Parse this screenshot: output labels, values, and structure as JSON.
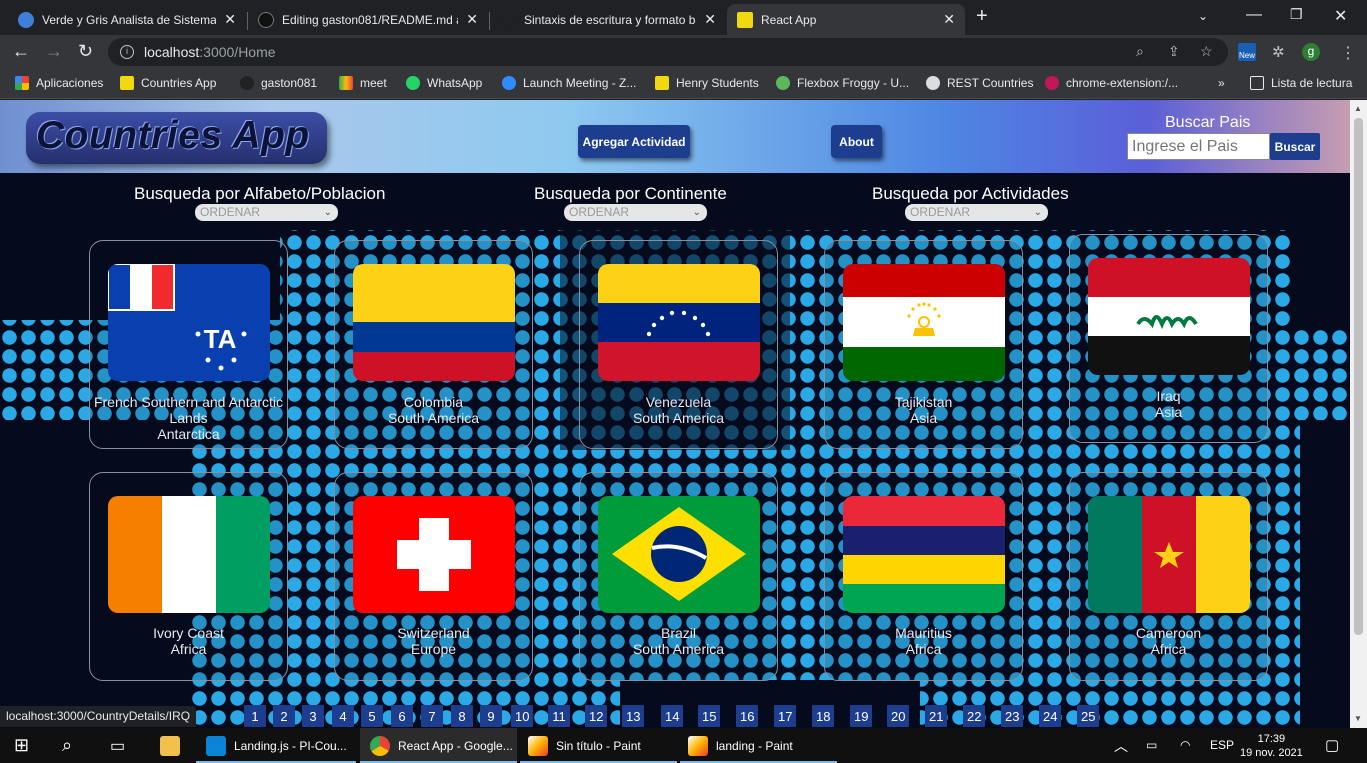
{
  "browser": {
    "tabs": [
      {
        "title": "Verde y Gris Analista de Sistemas",
        "active": false
      },
      {
        "title": "Editing gaston081/README.md a",
        "active": false
      },
      {
        "title": "Sintaxis de escritura y formato bá",
        "active": false
      },
      {
        "title": "React App",
        "active": true
      }
    ],
    "url_host": "localhost",
    "url_path": ":3000/Home",
    "bookmarks": [
      "Aplicaciones",
      "Countries App",
      "gaston081",
      "meet",
      "WhatsApp",
      "Launch Meeting - Z...",
      "Henry Students",
      "Flexbox Froggy - U...",
      "REST Countries",
      "chrome-extension:/..."
    ],
    "reading_list": "Lista de lectura",
    "extension_badge": "New",
    "profile_letter": "g"
  },
  "app": {
    "logo": "Countries App",
    "add_activity_label": "Agregar Actividad",
    "about_label": "About",
    "search": {
      "title": "Buscar Pais",
      "placeholder": "Ingrese el Pais",
      "button": "Buscar"
    },
    "filters": [
      {
        "title": "Busqueda por Alfabeto/Poblacion",
        "selected": "ORDENAR"
      },
      {
        "title": "Busqueda por Continente",
        "selected": "ORDENAR"
      },
      {
        "title": "Busqueda por Actividades",
        "selected": "ORDENAR"
      }
    ],
    "countries": [
      {
        "name": "French Southern and Antarctic Lands",
        "continent": "Antarctica",
        "flag": "french-southern-lands"
      },
      {
        "name": "Colombia",
        "continent": "South America",
        "flag": "colombia"
      },
      {
        "name": "Venezuela",
        "continent": "South America",
        "flag": "venezuela"
      },
      {
        "name": "Tajikistan",
        "continent": "Asia",
        "flag": "tajikistan"
      },
      {
        "name": "Iraq",
        "continent": "Asia",
        "flag": "iraq"
      },
      {
        "name": "Ivory Coast",
        "continent": "Africa",
        "flag": "ivory-coast"
      },
      {
        "name": "Switzerland",
        "continent": "Europe",
        "flag": "switzerland"
      },
      {
        "name": "Brazil",
        "continent": "South America",
        "flag": "brazil"
      },
      {
        "name": "Mauritius",
        "continent": "Africa",
        "flag": "mauritius"
      },
      {
        "name": "Cameroon",
        "continent": "Africa",
        "flag": "cameroon"
      }
    ],
    "pages": [
      "1",
      "2",
      "3",
      "4",
      "5",
      "6",
      "7",
      "8",
      "9",
      "10",
      "11",
      "12",
      "13",
      "14",
      "15",
      "16",
      "17",
      "18",
      "19",
      "20",
      "21",
      "22",
      "23",
      "24",
      "25"
    ],
    "status_url": "localhost:3000/CountryDetails/IRQ"
  },
  "taskbar": {
    "items": [
      {
        "label": "Landing.js - PI-Cou...",
        "active": false
      },
      {
        "label": "React App - Google...",
        "active": true
      },
      {
        "label": "Sin título - Paint",
        "active": false
      },
      {
        "label": "landing - Paint",
        "active": false
      }
    ],
    "language": "ESP",
    "time": "17:39",
    "date": "19 nov. 2021"
  }
}
